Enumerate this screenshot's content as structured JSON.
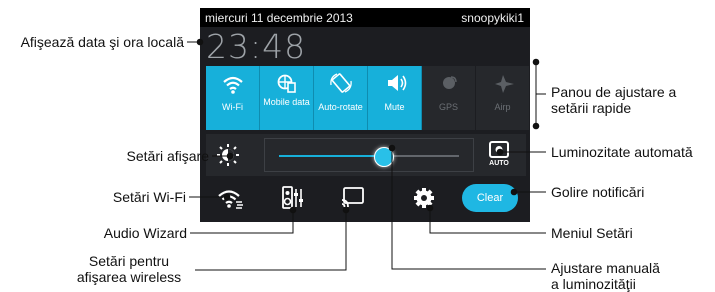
{
  "status_bar": {
    "date": "miercuri 11 decembrie 2013",
    "user": "snoopykiki1"
  },
  "clock": {
    "time": "23:48"
  },
  "quick_settings": {
    "tiles": [
      {
        "label": "Wi-Fi",
        "icon": "wifi-icon",
        "active": true
      },
      {
        "label": "Mobile data",
        "icon": "globe-sim-icon",
        "active": true
      },
      {
        "label": "Auto-rotate",
        "icon": "rotate-icon",
        "active": true
      },
      {
        "label": "Mute",
        "icon": "speaker-mute-icon",
        "active": true
      },
      {
        "label": "GPS",
        "icon": "gps-icon",
        "active": false
      },
      {
        "label": "Airp",
        "icon": "airplane-icon",
        "active": false
      }
    ]
  },
  "brightness": {
    "level": 0.58,
    "auto_label": "AUTO"
  },
  "bottom_row": {
    "clear_label": "Clear"
  },
  "callouts": {
    "date_time": "Afişează data şi ora locală",
    "quick_panel_line1": "Panou de ajustare a",
    "quick_panel_line2": "setării rapide",
    "display_settings": "Setări afişare",
    "auto_brightness": "Luminozitate automată",
    "wifi_settings": "Setări Wi-Fi",
    "clear_notifications": "Golire notificări",
    "audio_wizard": "Audio Wizard",
    "settings_menu": "Meniul Setări",
    "wireless_display_line1": "Setări pentru",
    "wireless_display_line2": "afişarea wireless",
    "manual_brightness_line1": "Ajustare manuală",
    "manual_brightness_line2": "a luminozităţii"
  },
  "colors": {
    "accent": "#17b0da",
    "panel_bg": "#1c1d21",
    "status_bg": "#000000"
  }
}
